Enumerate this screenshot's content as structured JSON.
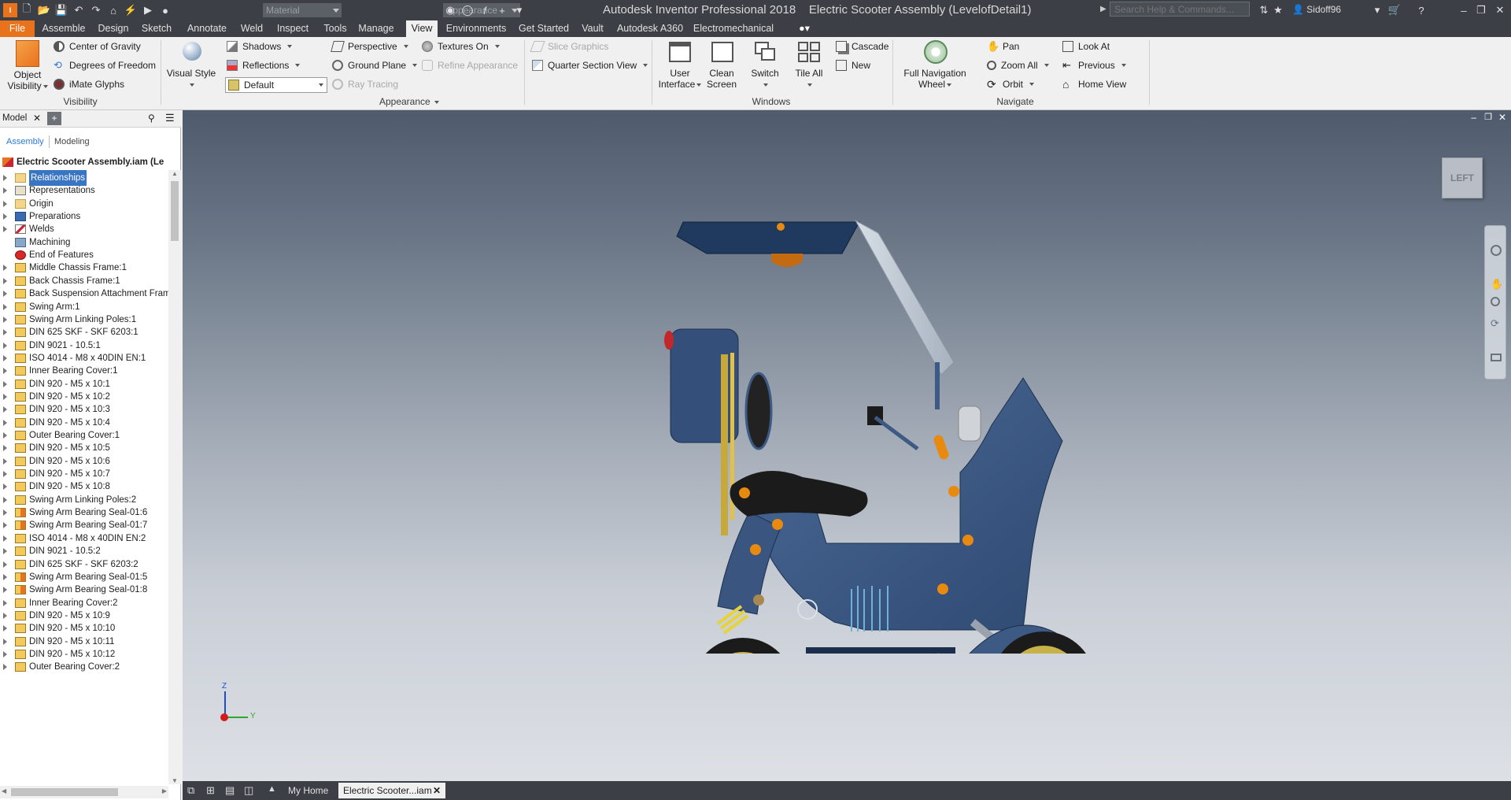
{
  "titlebar": {
    "app_title": "Autodesk Inventor Professional 2018",
    "doc_title": "Electric Scooter Assembly (LevelofDetail1)",
    "material_dropdown": "Material",
    "appearance_dropdown": "Appearance",
    "search_placeholder": "Search Help & Commands...",
    "user": "Sidoff96"
  },
  "tabs": [
    "File",
    "Assemble",
    "Design",
    "Sketch",
    "Annotate",
    "Weld",
    "Inspect",
    "Tools",
    "Manage",
    "View",
    "Environments",
    "Get Started",
    "Vault",
    "Autodesk A360",
    "Electromechanical"
  ],
  "active_tab": "View",
  "ribbon": {
    "visibility": {
      "label": "Visibility",
      "object_visibility": "Object Visibility",
      "center_of_gravity": "Center of Gravity",
      "degrees_of_freedom": "Degrees of Freedom",
      "imate_glyphs": "iMate Glyphs"
    },
    "appearance": {
      "label": "Appearance",
      "visual_style": "Visual Style",
      "shadows": "Shadows",
      "reflections": "Reflections",
      "style_value": "Default",
      "perspective": "Perspective",
      "ground_plane": "Ground Plane",
      "ray_tracing": "Ray Tracing",
      "textures_on": "Textures On",
      "refine_appearance": "Refine Appearance",
      "slice_graphics": "Slice Graphics",
      "quarter_section_view": "Quarter Section View"
    },
    "windows": {
      "label": "Windows",
      "user_interface": "User Interface",
      "clean_screen": "Clean Screen",
      "switch": "Switch",
      "tile_all": "Tile All",
      "cascade": "Cascade",
      "new": "New"
    },
    "navigate": {
      "label": "Navigate",
      "full_navigation_wheel": "Full Navigation Wheel",
      "pan": "Pan",
      "zoom_all": "Zoom All",
      "orbit": "Orbit",
      "look_at": "Look At",
      "previous": "Previous",
      "home_view": "Home View"
    }
  },
  "browser": {
    "panel_tab": "Model",
    "subtab_assembly": "Assembly",
    "subtab_modeling": "Modeling",
    "root": "Electric Scooter Assembly.iam (Le",
    "items": [
      {
        "label": "Relationships",
        "icon": "folder-icon"
      },
      {
        "label": "Representations",
        "icon": "representations-icon"
      },
      {
        "label": "Origin",
        "icon": "folder-icon"
      },
      {
        "label": "Preparations",
        "icon": "preparations-icon"
      },
      {
        "label": "Welds",
        "icon": "weld-icon"
      },
      {
        "label": "Machining",
        "icon": "machining-icon"
      },
      {
        "label": "End of Features",
        "icon": "end-of-features-icon"
      },
      {
        "label": "Middle Chassis Frame:1",
        "icon": "part-icon"
      },
      {
        "label": "Back Chassis Frame:1",
        "icon": "part-icon"
      },
      {
        "label": "Back Suspension Attachment Frame:",
        "icon": "part-icon"
      },
      {
        "label": "Swing Arm:1",
        "icon": "part-icon"
      },
      {
        "label": "Swing Arm Linking Poles:1",
        "icon": "part-icon"
      },
      {
        "label": "DIN 625 SKF - SKF 6203:1",
        "icon": "part-icon"
      },
      {
        "label": "DIN 9021 - 10.5:1",
        "icon": "part-icon"
      },
      {
        "label": "ISO 4014 - M8 x 40DIN EN:1",
        "icon": "part-icon"
      },
      {
        "label": "Inner Bearing  Cover:1",
        "icon": "part-icon"
      },
      {
        "label": "DIN 920 - M5 x 10:1",
        "icon": "part-icon"
      },
      {
        "label": "DIN 920 - M5 x 10:2",
        "icon": "part-icon"
      },
      {
        "label": "DIN 920 - M5 x 10:3",
        "icon": "part-icon"
      },
      {
        "label": "DIN 920 - M5 x 10:4",
        "icon": "part-icon"
      },
      {
        "label": "Outer Bearing Cover:1",
        "icon": "part-icon"
      },
      {
        "label": "DIN 920 - M5 x 10:5",
        "icon": "part-icon"
      },
      {
        "label": "DIN 920 - M5 x 10:6",
        "icon": "part-icon"
      },
      {
        "label": "DIN 920 - M5 x 10:7",
        "icon": "part-icon"
      },
      {
        "label": "DIN 920 - M5 x 10:8",
        "icon": "part-icon"
      },
      {
        "label": "Swing Arm Linking Poles:2",
        "icon": "part-icon"
      },
      {
        "label": "Swing Arm Bearing Seal-01:6",
        "icon": "subassembly-icon"
      },
      {
        "label": "Swing Arm Bearing Seal-01:7",
        "icon": "subassembly-icon"
      },
      {
        "label": "ISO 4014 - M8 x 40DIN EN:2",
        "icon": "part-icon"
      },
      {
        "label": "DIN 9021 - 10.5:2",
        "icon": "part-icon"
      },
      {
        "label": "DIN 625 SKF - SKF 6203:2",
        "icon": "part-icon"
      },
      {
        "label": "Swing Arm Bearing Seal-01:5",
        "icon": "subassembly-icon"
      },
      {
        "label": "Swing Arm Bearing Seal-01:8",
        "icon": "subassembly-icon"
      },
      {
        "label": "Inner Bearing  Cover:2",
        "icon": "part-icon"
      },
      {
        "label": "DIN 920 - M5 x 10:9",
        "icon": "part-icon"
      },
      {
        "label": "DIN 920 - M5 x 10:10",
        "icon": "part-icon"
      },
      {
        "label": "DIN 920 - M5 x 10:11",
        "icon": "part-icon"
      },
      {
        "label": "DIN 920 - M5 x 10:12",
        "icon": "part-icon"
      },
      {
        "label": "Outer Bearing Cover:2",
        "icon": "part-icon"
      }
    ]
  },
  "viewport": {
    "viewcube_face": "LEFT",
    "axis_z": "Z",
    "axis_y": "Y"
  },
  "status": {
    "tab_home": "My Home",
    "tab_doc": "Electric Scooter...iam"
  },
  "colors": {
    "file_tab": "#e9721c",
    "selection": "#3a75c4",
    "scooter_body": "#3d5a85",
    "accent_orange": "#e98a10",
    "wheel_rim": "#c7b24a"
  }
}
